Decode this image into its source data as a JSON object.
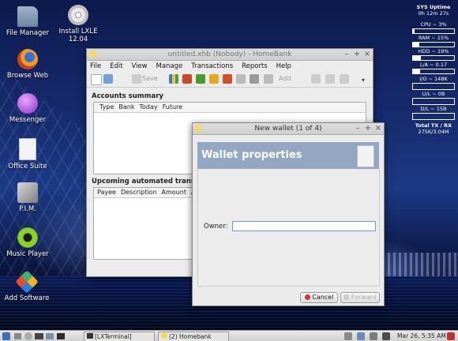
{
  "desktop": {
    "icons": [
      {
        "label": "File Manager",
        "icon": "folder-icon"
      },
      {
        "label": "Install LXLE\n12.04",
        "icon": "cd-icon"
      },
      {
        "label": "Browse Web",
        "icon": "firefox-icon"
      },
      {
        "label": "Messenger",
        "icon": "messenger-icon"
      },
      {
        "label": "Office Suite",
        "icon": "document-icon"
      },
      {
        "label": "P.I.M.",
        "icon": "pim-icon"
      },
      {
        "label": "Music Player",
        "icon": "music-icon"
      },
      {
        "label": "Add Software",
        "icon": "software-icon"
      }
    ]
  },
  "conky": {
    "uptime_label": "SYS Uptime",
    "uptime_value": "0h 12m 27s",
    "cpu": "CPU ~ 3%",
    "ram": "RAM ~ 15%",
    "hdd": "HDD ~ 19%",
    "load": "L/A ~ 0.17",
    "io": "I/O ~ 148K",
    "upload": "U/L ~ 0B",
    "download": "D/L ~ 15B",
    "total_label": "Total TX / RX",
    "total_value": "275K/3.04M",
    "cpu_level": 0.03,
    "ram_level": 0.15,
    "hdd_level": 0.19,
    "load_level": 0.17
  },
  "homebank": {
    "title": "untitled.xhb (Nobody) - HomeBank",
    "menu": [
      "File",
      "Edit",
      "View",
      "Manage",
      "Transactions",
      "Reports",
      "Help"
    ],
    "toolbar": {
      "save_label": "Save",
      "add_label": "Add"
    },
    "accounts_summary": {
      "title": "Accounts summary",
      "columns": [
        "Type",
        "Bank",
        "Today",
        "Future"
      ]
    },
    "upcoming": {
      "title": "Upcoming automated transactio",
      "columns": [
        "Payee",
        "Description",
        "Amount",
        "Ac"
      ]
    }
  },
  "wizard": {
    "title": "New wallet (1 of 4)",
    "heading": "Wallet properties",
    "owner_label": "Owner:",
    "owner_value": "",
    "cancel_label": "Cancel",
    "forward_label": "Forward"
  },
  "taskbar": {
    "tasks": [
      "[LXTerminal]",
      "(2) Homebank"
    ],
    "clock": "Mar 26, 5:35 AM"
  }
}
